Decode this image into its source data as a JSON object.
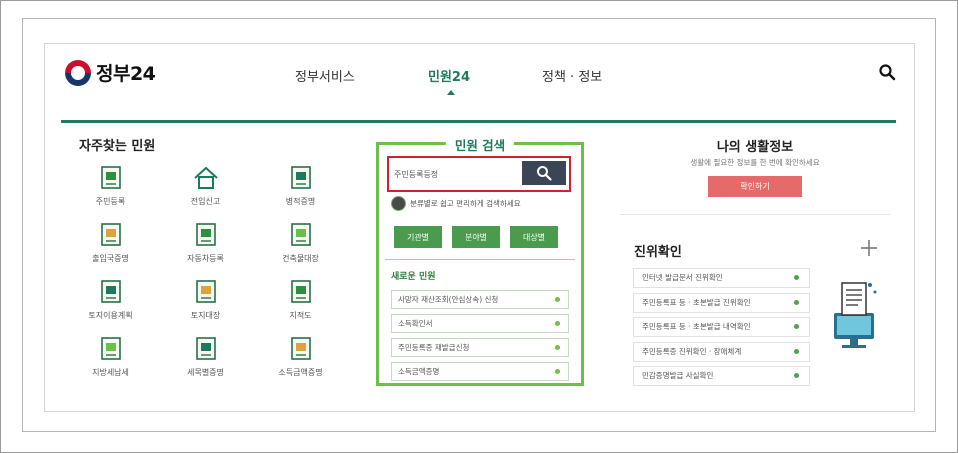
{
  "header": {
    "logo_text": "정부24",
    "nav": [
      "정부서비스",
      "민원24",
      "정책 · 정보"
    ],
    "active_nav": "민원24"
  },
  "frequent": {
    "title": "자주찾는 민원",
    "items": [
      {
        "label": "주민등록",
        "icon": "resident-registration-icon"
      },
      {
        "label": "전입신고",
        "icon": "house-icon"
      },
      {
        "label": "병적증명",
        "icon": "military-record-icon"
      },
      {
        "label": "출입국증명",
        "icon": "passport-icon"
      },
      {
        "label": "자동차등록",
        "icon": "car-registration-icon"
      },
      {
        "label": "건축물대장",
        "icon": "building-register-icon"
      },
      {
        "label": "토지이용계획",
        "icon": "land-use-icon"
      },
      {
        "label": "토지대장",
        "icon": "land-register-icon"
      },
      {
        "label": "지적도",
        "icon": "cadastral-map-icon"
      },
      {
        "label": "지방세납세",
        "icon": "local-tax-icon"
      },
      {
        "label": "세목별증명",
        "icon": "tax-certificate-icon"
      },
      {
        "label": "소득금액증명",
        "icon": "income-certificate-icon"
      }
    ]
  },
  "search": {
    "title": "민원 검색",
    "input_value": "주민등록등정",
    "help_text": "분류별로 쉽고 편리하게 검색하세요",
    "category_buttons": [
      "기관별",
      "분야별",
      "대상별"
    ],
    "new_title": "새로운 민원",
    "new_items": [
      "사망자 재산조회(안심상속) 신청",
      "소득확인서",
      "주민등록증 재발급신청",
      "소득금액증명"
    ]
  },
  "life": {
    "title": "나의 생활정보",
    "desc": "생활에 필요한 정보를 한 번에 확인하세요",
    "button": "확인하기"
  },
  "auth": {
    "title": "진위확인",
    "items": [
      "인터넷 발급문서 진위확인",
      "주민등록표 등 · 초본발급 진위확인",
      "주민등록표 등 · 초본발급 내역확인",
      "주민등록증 진위확인 · 장애체계",
      "민감증명발급 사실확인"
    ]
  },
  "colors": {
    "brand_green": "#1d7a5f",
    "panel_green": "#6cbf4a",
    "button_green": "#4a9b4e",
    "alert_red": "#d1202f",
    "life_button": "#e76a6b"
  }
}
